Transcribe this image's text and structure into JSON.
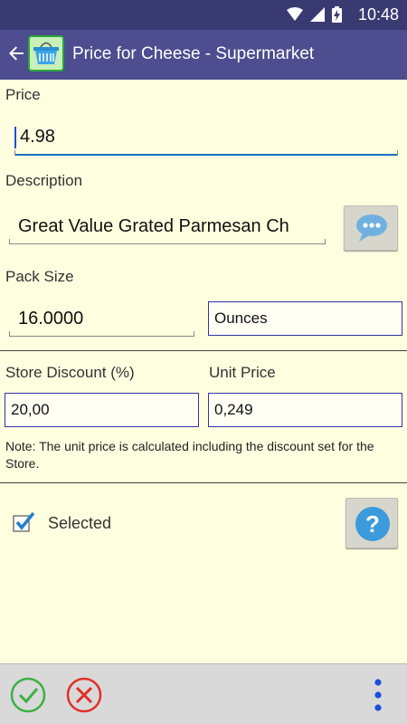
{
  "status": {
    "time": "10:48"
  },
  "header": {
    "title": "Price for Cheese - Supermarket"
  },
  "form": {
    "price_label": "Price",
    "price_value": "4.98",
    "description_label": "Description",
    "description_value": "Great Value Grated Parmesan Ch",
    "pack_size_label": "Pack Size",
    "pack_size_value": "16.0000",
    "unit_value": "Ounces",
    "store_discount_label": "Store Discount (%)",
    "store_discount_value": "20,00",
    "unit_price_label": "Unit Price",
    "unit_price_value": "0,249",
    "note": "Note: The unit price is calculated including the discount set for the Store.",
    "selected_label": "Selected",
    "selected_checked": true
  },
  "icons": {
    "back": "arrow-left-icon",
    "logo": "shopping-basket-icon",
    "description_picker": "speech-bubble-icon",
    "help": "question-mark-icon",
    "confirm": "check-circle-icon",
    "cancel": "cross-circle-icon",
    "more": "more-vertical-icon"
  },
  "colors": {
    "status_bar": "#3a3a72",
    "app_bar": "#4d4d8f",
    "background": "#ffffe0",
    "confirm": "#3cb043",
    "cancel": "#e0302a",
    "more": "#1a4fd8",
    "help": "#3b9bdc",
    "checkbox": "#1e7fd0"
  }
}
